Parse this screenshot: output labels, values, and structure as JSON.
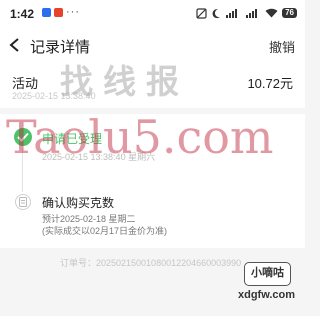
{
  "status_bar": {
    "time": "1:42",
    "battery": "76"
  },
  "nav": {
    "title": "记录详情",
    "cancel_label": "撤销"
  },
  "summary": {
    "label": "活动",
    "amount": "10.72元",
    "time": "2025-02-15 13:38:40"
  },
  "timeline": {
    "steps": [
      {
        "title": "申请已受理",
        "time": "2025-02-15 13:38:40 星期六",
        "status": "done"
      },
      {
        "title": "确认购买克数",
        "time": "预计2025-02-18 星期二",
        "note": "(实际成交以02月17日金价为准)",
        "status": "pending"
      }
    ]
  },
  "order": {
    "number": "订单号：20250215001080012204660003990"
  },
  "watermarks": {
    "top": "找线报",
    "middle": "Taolu5.com",
    "badge": "小嘀咕",
    "badge_url": "xdgfw.com"
  },
  "colors": {
    "success": "#4cc36b",
    "page_bg": "#f5f5f5"
  }
}
